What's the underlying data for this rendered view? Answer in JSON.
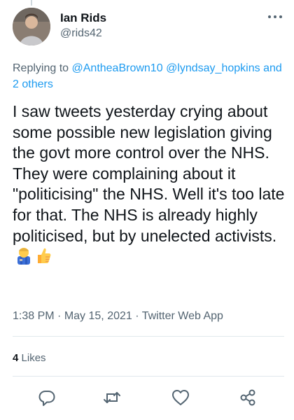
{
  "tweet": {
    "author": {
      "display_name": "Ian Rids",
      "handle": "@rids42"
    },
    "replying_to": {
      "prefix": "Replying to",
      "mentions": [
        "@AntheaBrown10",
        "@lyndsay_hopkins"
      ],
      "others": "and 2 others"
    },
    "text": "I saw tweets yesterday crying about some possible new legislation giving the govt more control over the NHS. They were complaining about it \"politicising\" the NHS. Well it's too late for that. The NHS is already highly politicised, but by unelected activists.",
    "emojis": [
      "🧑‍🔧",
      "👍"
    ],
    "meta": {
      "time": "1:38 PM",
      "date": "May 15, 2021",
      "source": "Twitter Web App",
      "separator": "·"
    },
    "stats": {
      "likes_count": "4",
      "likes_label": "Likes"
    }
  },
  "icons": {
    "more": "more-horizontal-icon",
    "reply": "reply-bubble-icon",
    "retweet": "retweet-icon",
    "like": "heart-icon",
    "share": "share-icon"
  },
  "colors": {
    "link": "#1d9bf0",
    "secondary_text": "#536471",
    "primary_text": "#0f1419",
    "divider": "#e1e8ed"
  }
}
